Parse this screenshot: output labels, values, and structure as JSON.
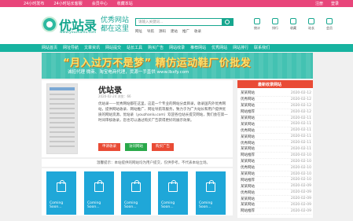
{
  "topbar": {
    "links": [
      "24小时发布",
      "24小时站长客服",
      "会员中心",
      "收藏本站"
    ],
    "right": [
      "注册",
      "登录"
    ]
  },
  "header": {
    "logo_text": "优站录",
    "logo_url": "www.youzhanlu.com",
    "slogan": "优秀网站 都在这里",
    "search_placeholder": "请输入关键词...",
    "hotwords": [
      "网址",
      "导航",
      "源码",
      "建站",
      "推广",
      "收录"
    ],
    "quick_icons": [
      "统计",
      "排行",
      "收藏",
      "站长",
      "会员"
    ]
  },
  "nav": {
    "items": [
      "网站首页",
      "网址导航",
      "文章资讯",
      "网站提交",
      "站长工具",
      "购买广告",
      "网站收录",
      "推荐网站",
      "优秀网站",
      "网站排行",
      "联系我们"
    ]
  },
  "banner": {
    "headline": "“月入过万不是梦” 精仿运动鞋厂价批发",
    "sub": "诚招代理  微商、淘宝电商代理，货源一手直供  www.lbxfy.com"
  },
  "main": {
    "title": "优站录",
    "meta": "2020-02-24  浏览：66",
    "desc": "优站录——优秀网站都在这里，这是一个专业的网站分类目录，收录国内外优秀网站，提供网站收录、网站推广、网址导航等服务，致力于为广大站长和用户提供优质的网站资源。优站录（youzhanlu.com）欢迎各位站长提交网站，我们会在第一时间审核收录，您也可以通过购买广告获得更好的展示效果。",
    "buttons": {
      "apply": "申请收录",
      "visit": "访问网站",
      "buy": "购买广告"
    }
  },
  "notice": {
    "text": "温馨提示：本站提供的网站均为用户提交，仅供参考，不代表本站立场。"
  },
  "cards": {
    "label": "Coming Soon..."
  },
  "sidebar": {
    "title": "最新收录网站",
    "items": [
      {
        "title": "某某网站",
        "date": "2020-02-12"
      },
      {
        "title": "优秀网站",
        "date": "2020-02-12"
      },
      {
        "title": "某某网站",
        "date": "2020-02-12"
      },
      {
        "title": "网站推荐",
        "date": "2020-02-12"
      },
      {
        "title": "某某网站",
        "date": "2020-02-11"
      },
      {
        "title": "某某网站",
        "date": "2020-02-11"
      },
      {
        "title": "优秀网站",
        "date": "2020-02-11"
      },
      {
        "title": "某某网站",
        "date": "2020-02-11"
      },
      {
        "title": "优秀网站",
        "date": "2020-02-11"
      },
      {
        "title": "某某网站",
        "date": "2020-02-11"
      },
      {
        "title": "网站推荐",
        "date": "2020-02-10"
      },
      {
        "title": "某某网站",
        "date": "2020-02-10"
      },
      {
        "title": "优秀网站",
        "date": "2020-02-10"
      },
      {
        "title": "某某网站",
        "date": "2020-02-10"
      },
      {
        "title": "网站推荐",
        "date": "2020-02-10"
      },
      {
        "title": "某某网站",
        "date": "2020-02-09"
      },
      {
        "title": "优秀网站",
        "date": "2020-02-09"
      },
      {
        "title": "某某网站",
        "date": "2020-02-09"
      },
      {
        "title": "某某网站",
        "date": "2020-02-09"
      },
      {
        "title": "网站推荐",
        "date": "2020-02-09"
      }
    ]
  }
}
